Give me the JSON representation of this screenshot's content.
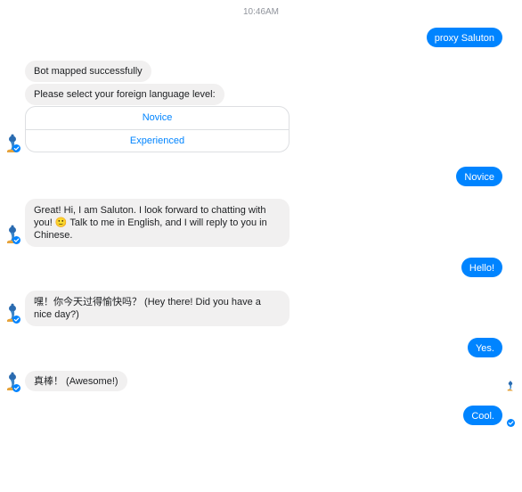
{
  "header": {
    "timestamp": "10:46AM"
  },
  "messages": {
    "user_1": "proxy Saluton",
    "bot_1a": "Bot mapped successfully",
    "bot_1b": "Please select your foreign language level:",
    "quick_replies": [
      "Novice",
      "Experienced"
    ],
    "user_2": "Novice",
    "bot_2": "Great! Hi, I am Saluton. I look forward to chatting with you! 🙂 Talk to me in English, and I will reply to you in Chinese.",
    "user_3": "Hello!",
    "bot_3": "嘿！你今天过得愉快吗？ (Hey there! Did you have a nice day?)",
    "user_4": "Yes.",
    "bot_4": "真棒！ (Awesome!)",
    "user_5": "Cool."
  },
  "colors": {
    "brand_blue": "#0084ff",
    "incoming_bubble": "#f1f0f0",
    "timestamp_gray": "#90949c"
  },
  "icons": {
    "bot_avatar": "genie-lamp-icon",
    "delivered": "check-circle-icon",
    "seen_by": "genie-lamp-icon"
  }
}
